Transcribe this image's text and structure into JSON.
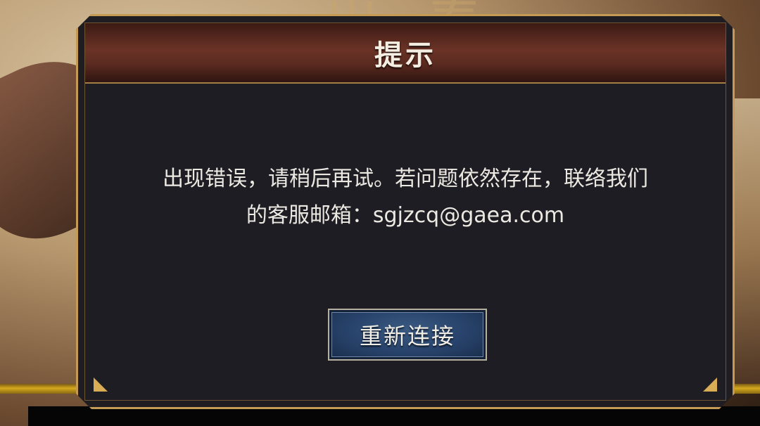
{
  "dialog": {
    "title": "提示",
    "message_line1": "出现错误，请稍后再试。若问题依然存在，联络我们",
    "message_line2": "的客服邮箱：sgjzcq@gaea.com",
    "button_label": "重新连接"
  },
  "colors": {
    "frame_gold": "#c59a52",
    "header_red": "#6a3326",
    "panel_dark": "#1e1d23",
    "button_blue": "#27426a",
    "text_light": "#ece9e2"
  }
}
